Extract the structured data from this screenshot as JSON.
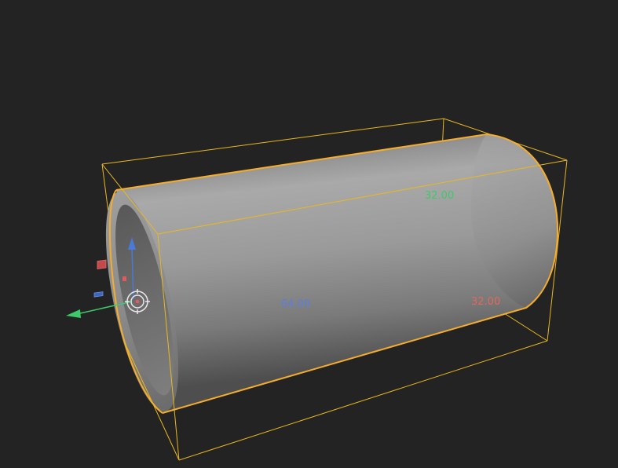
{
  "dimensions": {
    "y_label": "32.00",
    "z_label": "64.00",
    "x_label": "32.00"
  },
  "colors": {
    "background": "#232323",
    "selection": "#f5ad2b",
    "bbox": "#e9b820",
    "axis_x": "#e05b5b",
    "axis_y": "#3ec96a",
    "axis_z": "#4a7ad6",
    "dim_y": "#3ec96a",
    "dim_z": "#5a7fe0",
    "dim_x": "#e06a5a"
  },
  "icons": {
    "gizmo": "move-gizmo-icon",
    "pivot": "pivot-crosshair-icon",
    "plane_xz": "plane-handle-red-icon",
    "plane_yz": "plane-handle-blue-icon"
  }
}
